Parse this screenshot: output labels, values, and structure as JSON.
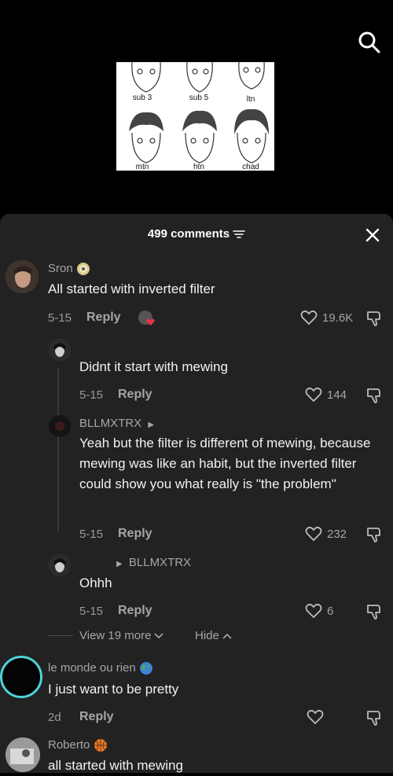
{
  "video_thumb": {
    "labels": [
      "sub 3",
      "sub 5",
      "ltn",
      "mtn",
      "htn",
      "chad"
    ]
  },
  "sheet": {
    "comment_count_label": "499 comments"
  },
  "comments": [
    {
      "username": "Sron",
      "text": "All started with inverted filter",
      "date": "5-15",
      "reply_label": "Reply",
      "likes": "19.6K"
    },
    {
      "username": "",
      "text": "Didnt it start with mewing",
      "date": "5-15",
      "reply_label": "Reply",
      "likes": "144"
    },
    {
      "username": "BLLMXTRX",
      "text": "Yeah but the filter is different of mewing, because mewing was like an habit, but the inverted filter could show you what really is \"the problem\"",
      "date": "5-15",
      "reply_label": "Reply",
      "likes": "232"
    },
    {
      "reply_to": "BLLMXTRX",
      "text": "Ohhh",
      "date": "5-15",
      "reply_label": "Reply",
      "likes": "6"
    },
    {
      "username": "le monde ou rien",
      "text": "I just want to be pretty",
      "date": "2d",
      "reply_label": "Reply"
    },
    {
      "username": "Roberto",
      "text": "all started with mewing"
    }
  ],
  "thread": {
    "view_more_label": "View 19 more",
    "hide_label": "Hide"
  },
  "colors": {
    "sheet_bg": "#222222",
    "like_heart_red": "#e8334a",
    "story_ring": "#4fd1d9"
  }
}
